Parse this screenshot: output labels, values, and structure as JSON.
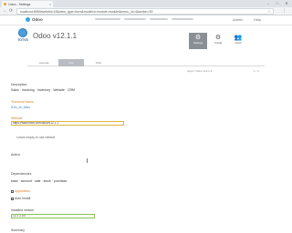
{
  "browser": {
    "tab_title": "Odoo - Settings",
    "tab_close": "×",
    "url": "localhost:8069/web#id=18&view_type=form&model=ir.module.module&menu_id=4&action=39",
    "win_minimize": "–",
    "win_maximize": "□",
    "win_close": "✕"
  },
  "appbar": {
    "brand": "Odoo",
    "right_a": "Admin",
    "right_b": "Help"
  },
  "title": {
    "logo_text": "TOTVS",
    "record_name": "Odoo v12.1.1"
  },
  "stats": [
    {
      "label": "Settings",
      "icon": "gear-icon",
      "glyph": "⚙"
    },
    {
      "label": "Config",
      "icon": "cog-icon",
      "glyph": "⚙"
    },
    {
      "label": "Users",
      "icon": "users-icon",
      "glyph": "👥"
    }
  ],
  "tabs": [
    "General",
    "Info",
    "Tech"
  ],
  "breadcrumb_left": "Apps / Odoo v12.1.1",
  "breadcrumb_right": "1 / 1",
  "form": {
    "section1_label": "Description",
    "section1_line": "Sales  ·  Invoicing  ·  Inventory  ·  Website  ·  CRM",
    "section2_label": "Technical Name",
    "section2_value": "l10n_br_totvs",
    "section3_label": "Website",
    "section3_input": "https://www.totvs.com/odoo/v12.1.1",
    "section3_hint": "Leave empty to use default",
    "section4_label": "Author",
    "section5_label": "Dependencies",
    "section5_line": "base  ·  account  ·  sale  ·  stock  ·  purchase",
    "check1": "Application",
    "check2": "Auto Install",
    "section6_label": "Installed version",
    "section6_input": "12.1.1.0.0",
    "footer_label": "Summary"
  },
  "colors": {
    "accent": "#d9822b",
    "link": "#3b78b4",
    "active_tab": "#b9bcc0",
    "stat_active": "#8a8f95"
  }
}
